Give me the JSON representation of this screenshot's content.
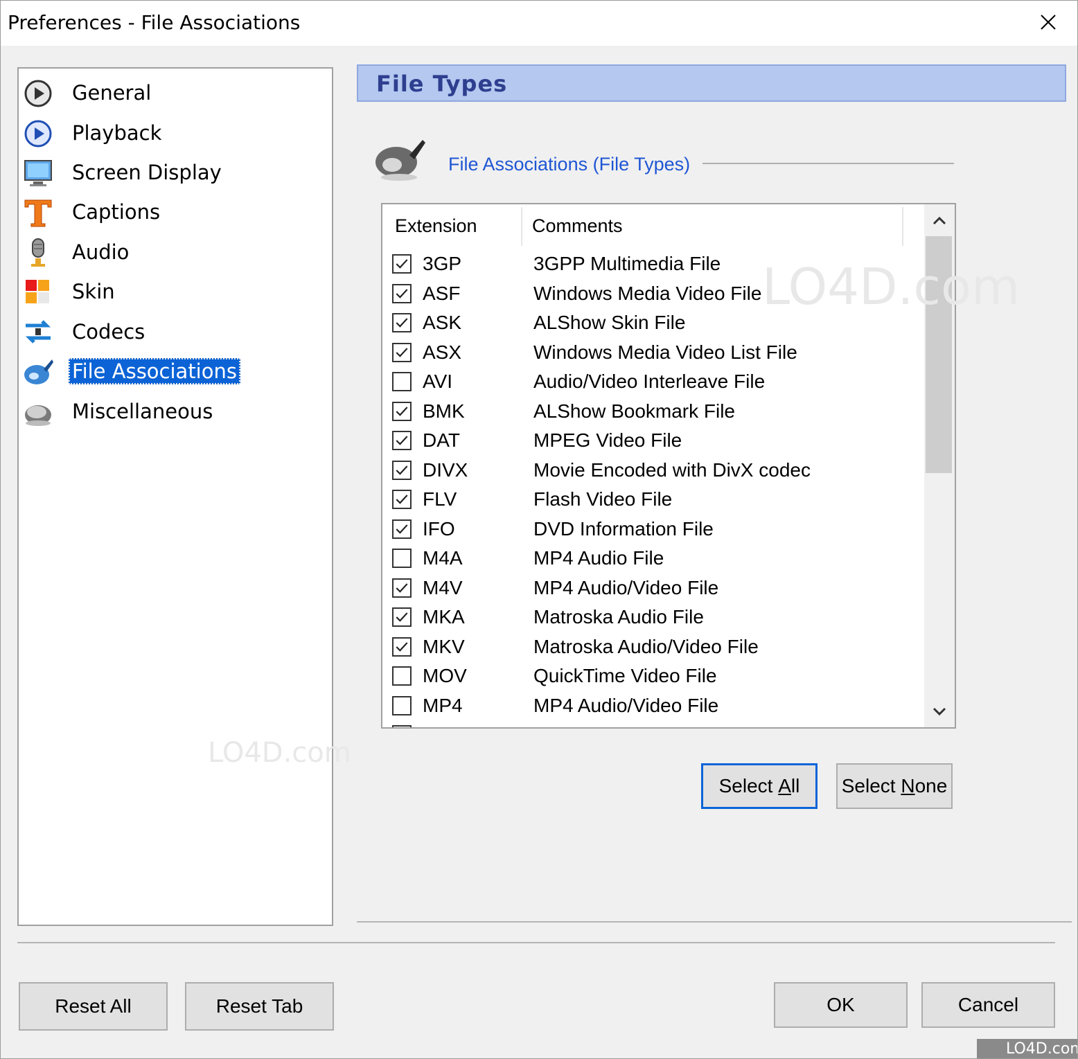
{
  "window": {
    "title": "Preferences - File Associations"
  },
  "nav": {
    "items": [
      {
        "label": "General",
        "icon": "general-play-icon"
      },
      {
        "label": "Playback",
        "icon": "playback-icon"
      },
      {
        "label": "Screen Display",
        "icon": "monitor-icon"
      },
      {
        "label": "Captions",
        "icon": "caption-t-icon"
      },
      {
        "label": "Audio",
        "icon": "microphone-icon"
      },
      {
        "label": "Skin",
        "icon": "skin-tiles-icon"
      },
      {
        "label": "Codecs",
        "icon": "codecs-icon"
      },
      {
        "label": "File Associations",
        "icon": "file-associations-icon"
      },
      {
        "label": "Miscellaneous",
        "icon": "miscellaneous-icon"
      }
    ],
    "selected": "File Associations"
  },
  "panel": {
    "header": "File Types",
    "section_title": "File Associations (File Types)"
  },
  "list": {
    "columns": [
      "Extension",
      "Comments"
    ],
    "rows": [
      {
        "ext": "3GP",
        "comment": "3GPP Multimedia File",
        "checked": true
      },
      {
        "ext": "ASF",
        "comment": "Windows Media Video File",
        "checked": true
      },
      {
        "ext": "ASK",
        "comment": "ALShow Skin File",
        "checked": true
      },
      {
        "ext": "ASX",
        "comment": "Windows Media Video List File",
        "checked": true
      },
      {
        "ext": "AVI",
        "comment": "Audio/Video Interleave File",
        "checked": false
      },
      {
        "ext": "BMK",
        "comment": "ALShow Bookmark File",
        "checked": true
      },
      {
        "ext": "DAT",
        "comment": "MPEG Video File",
        "checked": true
      },
      {
        "ext": "DIVX",
        "comment": "Movie Encoded with DivX codec",
        "checked": true
      },
      {
        "ext": "FLV",
        "comment": "Flash Video File",
        "checked": true
      },
      {
        "ext": "IFO",
        "comment": "DVD Information File",
        "checked": true
      },
      {
        "ext": "M4A",
        "comment": "MP4 Audio File",
        "checked": false
      },
      {
        "ext": "M4V",
        "comment": "MP4 Audio/Video File",
        "checked": true
      },
      {
        "ext": "MKA",
        "comment": "Matroska Audio File",
        "checked": true
      },
      {
        "ext": "MKV",
        "comment": "Matroska Audio/Video File",
        "checked": true
      },
      {
        "ext": "MOV",
        "comment": "QuickTime Video File",
        "checked": false
      },
      {
        "ext": "MP4",
        "comment": "MP4 Audio/Video File",
        "checked": false
      }
    ]
  },
  "buttons": {
    "select_all_pre": "Select ",
    "select_all_key": "A",
    "select_all_post": "ll",
    "select_none_pre": "Select ",
    "select_none_key": "N",
    "select_none_post": "one",
    "reset_all": "Reset All",
    "reset_tab": "Reset Tab",
    "ok": "OK",
    "cancel": "Cancel"
  },
  "watermark": {
    "text": "LO4D.com"
  },
  "colors": {
    "selection": "#0b63d6",
    "header_band": "#b4c8f0",
    "link_blue": "#1f56d4",
    "header_text": "#2f3f8f"
  }
}
